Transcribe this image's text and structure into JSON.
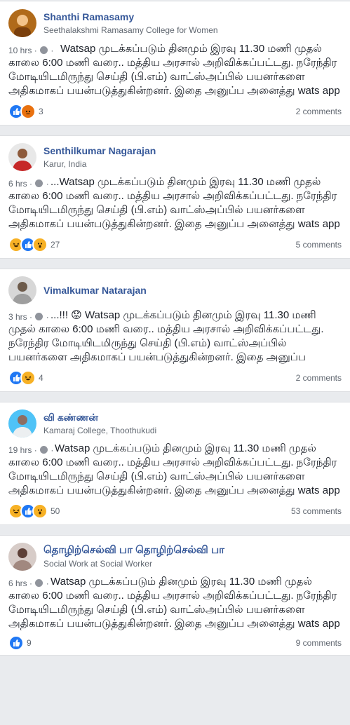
{
  "posts": [
    {
      "author": "Shanthi Ramasamy",
      "subtitle": "Seethalakshmi Ramasamy College for Women",
      "time": "10 hrs",
      "body": "Watsap முடக்கப்படும் தினமும் இரவு 11.30 மணி முதல் காலை 6:00 மணி வரை.. மத்திய அரசால் அறிவிக்கப்பட்டது. நரேந்திர மோடியிடமிருந்து செய்தி (பி.எம்) வாட்ஸ்அப்பில் பயனர்களை அதிகமாகப் பயன்படுத்துகின்றனர். இதை அனுப்ப அனைத்து wats app userயும் கேட்டுக்கொள்கிறோம்...",
      "reactions": [
        "like",
        "angry"
      ],
      "reaction_count": "3",
      "comments": "2 comments",
      "avatar_color": "#b06a1a"
    },
    {
      "author": "Senthilkumar Nagarajan",
      "subtitle": "Karur, India",
      "time": "6 hrs",
      "body": "...Watsap முடக்கப்படும் தினமும் இரவு 11.30 மணி முதல் காலை 6:00 மணி வரை.. மத்திய அரசால் அறிவிக்கப்பட்டது. நரேந்திர மோடியிடமிருந்து செய்தி (பி.எம்) வாட்ஸ்அப்பில் பயனர்களை அதிகமாகப் பயன்படுத்துகின்றனர். இதை அனுப்ப அனைத்து wats app userயும் கேட்டுக்கொள்கிறோம்...",
      "reactions": [
        "haha",
        "like",
        "wow"
      ],
      "reaction_count": "27",
      "comments": "5 comments",
      "avatar_color": "#c62828"
    },
    {
      "author": "Vimalkumar Natarajan",
      "subtitle": "",
      "time": "3 hrs",
      "body": "...!!! 😟 Watsap முடக்கப்படும் தினமும் இரவு 11.30 மணி முதல் காலை 6:00 மணி வரை.. மத்திய அரசால் அறிவிக்கப்பட்டது. நரேந்திர மோடியிடமிருந்து செய்தி (பி.எம்) வாட்ஸ்அப்பில் பயனர்களை அதிகமாகப் பயன்படுத்துகின்றனர். இதை அனுப்ப அனைத்து wats app...",
      "reactions": [
        "like",
        "haha"
      ],
      "reaction_count": "4",
      "comments": "2 comments",
      "avatar_color": "#9e9e9e"
    },
    {
      "author": "வி கண்ணன்",
      "subtitle": "Kamaraj College, Thoothukudi",
      "time": "19 hrs",
      "body": "Watsap முடக்கப்படும் தினமும் இரவு 11.30 மணி முதல் காலை 6:00 மணி வரை.. மத்திய அரசால் அறிவிக்கப்பட்டது. நரேந்திர மோடியிடமிருந்து செய்தி (பி.எம்) வாட்ஸ்அப்பில் பயனர்களை அதிகமாகப் பயன்படுத்துகின்றனர். இதை அனுப்ப அனைத்து wats app userயும் கேட்டுக்கொள்கிறோம்...",
      "reactions": [
        "haha",
        "like",
        "wow"
      ],
      "reaction_count": "50",
      "comments": "53 comments",
      "avatar_color": "#4fc3f7"
    },
    {
      "author": "தொழிற்செல்வி பா தொழிற்செல்வி பா",
      "subtitle": "Social Work at Social Worker",
      "time": "6 hrs",
      "body": "Watsap முடக்கப்படும் தினமும் இரவு 11.30 மணி முதல் காலை 6:00 மணி வரை.. மத்திய அரசால் அறிவிக்கப்பட்டது. நரேந்திர மோடியிடமிருந்து செய்தி (பி.எம்) வாட்ஸ்அப்பில் பயனர்களை அதிகமாகப் பயன்படுத்துகின்றனர். இதை அனுப்ப அனைத்து wats app userயும் கேட்டுக்கொள்கிறோம்...",
      "reactions": [
        "like"
      ],
      "reaction_count": "9",
      "comments": "9 comments",
      "avatar_color": "#a1887f"
    }
  ]
}
